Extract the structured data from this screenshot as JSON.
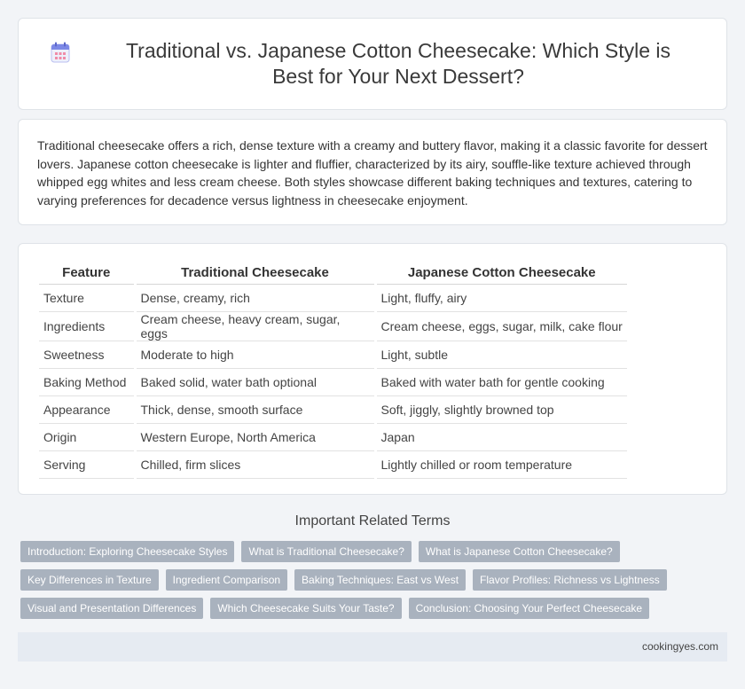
{
  "header": {
    "icon": "calendar-icon",
    "title": "Traditional vs. Japanese Cotton Cheesecake: Which Style is Best for Your Next Dessert?"
  },
  "intro": {
    "text": "Traditional cheesecake offers a rich, dense texture with a creamy and buttery flavor, making it a classic favorite for dessert lovers. Japanese cotton cheesecake is lighter and fluffier, characterized by its airy, souffle-like texture achieved through whipped egg whites and less cream cheese. Both styles showcase different baking techniques and textures, catering to varying preferences for decadence versus lightness in cheesecake enjoyment."
  },
  "table": {
    "headers": [
      "Feature",
      "Traditional Cheesecake",
      "Japanese Cotton Cheesecake"
    ],
    "rows": [
      [
        "Texture",
        "Dense, creamy, rich",
        "Light, fluffy, airy"
      ],
      [
        "Ingredients",
        "Cream cheese, heavy cream, sugar, eggs",
        "Cream cheese, eggs, sugar, milk, cake flour"
      ],
      [
        "Sweetness",
        "Moderate to high",
        "Light, subtle"
      ],
      [
        "Baking Method",
        "Baked solid, water bath optional",
        "Baked with water bath for gentle cooking"
      ],
      [
        "Appearance",
        "Thick, dense, smooth surface",
        "Soft, jiggly, slightly browned top"
      ],
      [
        "Origin",
        "Western Europe, North America",
        "Japan"
      ],
      [
        "Serving",
        "Chilled, firm slices",
        "Lightly chilled or room temperature"
      ]
    ]
  },
  "related": {
    "heading": "Important Related Terms",
    "tags": [
      [
        "Introduction: Exploring Cheesecake Styles",
        "What is Traditional Cheesecake?",
        "What is Japanese Cotton Cheesecake?"
      ],
      [
        "Key Differences in Texture",
        "Ingredient Comparison",
        "Baking Techniques: East vs West",
        "Flavor Profiles: Richness vs Lightness"
      ],
      [
        "Visual and Presentation Differences",
        "Which Cheesecake Suits Your Taste?",
        "Conclusion: Choosing Your Perfect Cheesecake"
      ]
    ]
  },
  "footer": {
    "site": "cookingyes.com"
  }
}
